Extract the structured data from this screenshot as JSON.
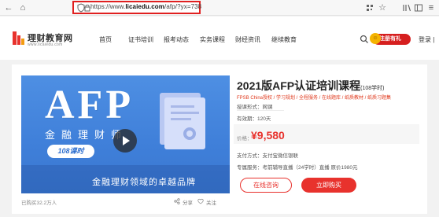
{
  "browser": {
    "url_prefix": "https://www.",
    "url_domain": "licaiedu.com",
    "url_path": "/afp/?yx=738"
  },
  "header": {
    "logo_title": "理财教育网",
    "logo_subtitle": "www.licaiedu.com",
    "nav": [
      "首页",
      "证书培训",
      "报考动态",
      "实务课程",
      "财经资讯",
      "继续教育"
    ],
    "register_label": "注册有礼",
    "login_label": "登录 |"
  },
  "banner": {
    "brand": "AFP",
    "tagline": "金融理财师",
    "hours": "108课时",
    "slogan": "金融理财领域的卓越品牌"
  },
  "course": {
    "title": "2021版AFP认证培训课程",
    "title_hours": "(108学时)",
    "tags": "FPSB China授权 / 学习规划 / 全程服务 / 在线题库 / 纸质教材 / 纸质习题集",
    "format": "授课形式：网课",
    "validity": "有效期：120天",
    "price_label": "价格：",
    "price": "¥9,580",
    "payment": "支付方式：支付宝微信银联",
    "extra": "专属服务：考前辅导直播（24学时）直播 原价1980元",
    "bought": "已购买32.2万人",
    "share_label": "分享",
    "follow_label": "关注",
    "consult_label": "在线咨询",
    "buy_label": "立即购买"
  },
  "colors": {
    "accent": "#e8322d",
    "banner": "#4a88e0"
  }
}
